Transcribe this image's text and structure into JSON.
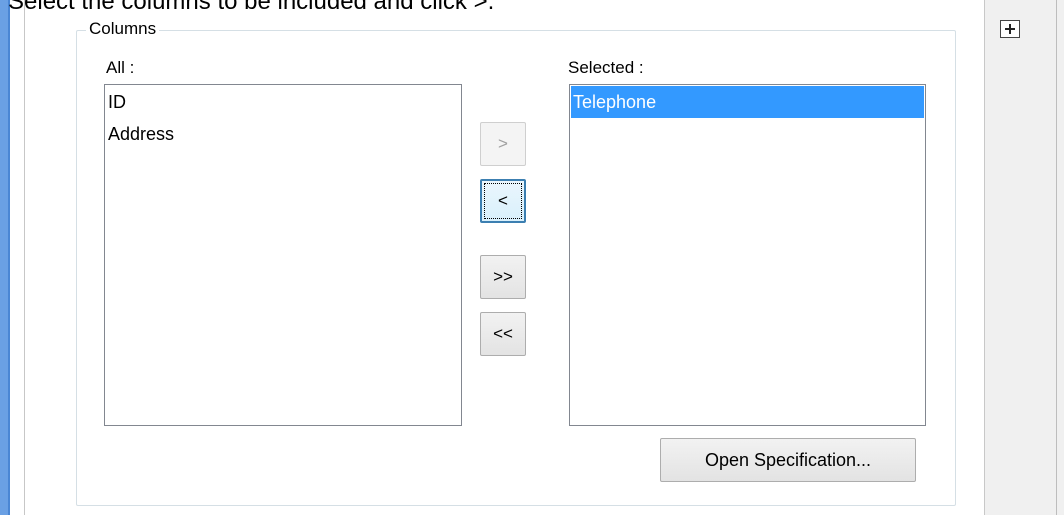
{
  "instruction": "Select the columns to be included and click >.",
  "columns_group": {
    "title": "Columns",
    "all_label": "All :",
    "all_items": [
      "ID",
      "Address"
    ],
    "selected_label": "Selected :",
    "selected_items": [
      "Telephone"
    ],
    "selected_item_highlighted": "Telephone"
  },
  "buttons": {
    "add": ">",
    "remove": "<",
    "add_all": ">>",
    "remove_all": "<<",
    "open_spec": "Open Specification..."
  },
  "colors": {
    "selection": "#3399ff",
    "accent_bar": "#6aa0e4"
  }
}
